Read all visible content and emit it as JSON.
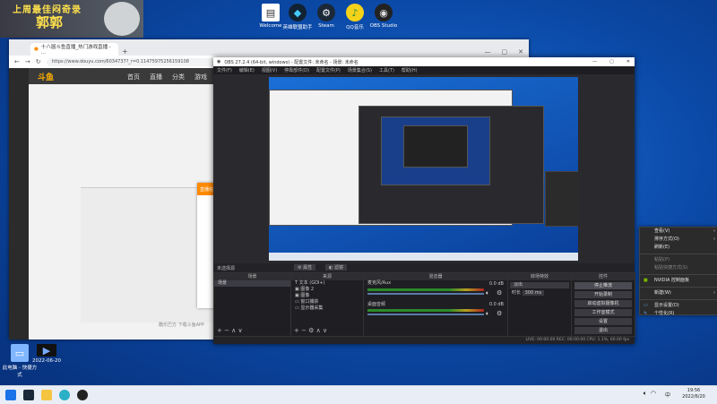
{
  "banner": {
    "title": "上周最佳闷奇录",
    "name": "郭郭"
  },
  "desktop_icons": [
    {
      "label": "Welcome",
      "icon": "document-icon"
    },
    {
      "label": "英雄联盟助手",
      "icon": "game-icon"
    },
    {
      "label": "Steam",
      "icon": "steam-icon"
    },
    {
      "label": "QQ音乐",
      "icon": "music-icon"
    },
    {
      "label": "OBS Studio",
      "icon": "obs-icon"
    }
  ],
  "desktop_bottom_icons": [
    {
      "label": "此电脑 - 快捷方式",
      "icon": "computer-icon"
    },
    {
      "label": "2022-06-20",
      "icon": "video-thumbnail-icon"
    }
  ],
  "browser": {
    "tab_title": "十八届斗鱼直播_热门游戏直播 - ...",
    "url": "https://www.douyu.com/6034737?_r=0.1147597525615910​8",
    "site_logo": "斗鱼",
    "nav": [
      "首页",
      "直播",
      "分类",
      "游戏"
    ],
    "popup_title": "直播信息",
    "footer_text": "酷乐巴方  下载斗鱼APP"
  },
  "obs": {
    "title": "OBS 27.2.4 (64-bit, windows) - 配置文件: 未命名 - 场景: 未命名",
    "menus": [
      "文件(F)",
      "编辑(E)",
      "视图(V)",
      "停靠部件(D)",
      "配置文件(P)",
      "场景集合(S)",
      "工具(T)",
      "帮助(H)"
    ],
    "source_bar": {
      "label": "未选择源",
      "props": "属性",
      "filters": "滤镜"
    },
    "scenes": {
      "title": "场景",
      "items": [
        "场景"
      ]
    },
    "sources": {
      "title": "来源",
      "items": [
        "文本 (GDI+)",
        "图像 2",
        "图像",
        "窗口捕获",
        "显示器采集"
      ]
    },
    "mixer": {
      "title": "混音器",
      "tracks": [
        {
          "name": "麦克风/Aux",
          "db": "0.0 dB"
        },
        {
          "name": "桌面音频",
          "db": "0.0 dB"
        }
      ]
    },
    "transitions": {
      "title": "转场特效",
      "type": "淡出",
      "duration_label": "时长",
      "duration": "300 ms"
    },
    "controls": {
      "title": "控件",
      "buttons": [
        "停止推流",
        "开始录制",
        "启动虚拟摄像机",
        "工作室模式",
        "设置",
        "退出"
      ]
    },
    "status": "LIVE: 00:00:00   REC: 00:00:00   CPU: 1.1%, 60.00 fps"
  },
  "context_menu": {
    "items": [
      {
        "label": "查看(V)",
        "sub": true,
        "dim": false
      },
      {
        "label": "排序方式(O)",
        "sub": true,
        "dim": false
      },
      {
        "label": "刷新(E)",
        "sub": false,
        "dim": false
      },
      {
        "sep": true
      },
      {
        "label": "粘贴(P)",
        "sub": false,
        "dim": true
      },
      {
        "label": "粘贴快捷方式(S)",
        "sub": false,
        "dim": true
      },
      {
        "sep": true
      },
      {
        "label": "NVIDIA 控制面板",
        "sub": false,
        "dim": false
      },
      {
        "sep": true
      },
      {
        "label": "新建(W)",
        "sub": true,
        "dim": false
      },
      {
        "sep": true
      },
      {
        "label": "显示设置(D)",
        "sub": false,
        "dim": false
      },
      {
        "label": "个性化(R)",
        "sub": false,
        "dim": false
      }
    ]
  },
  "taskbar": {
    "time": "19:56",
    "date": "2022/6/20",
    "lang": "中",
    "apps": [
      "windows-icon",
      "search-icon",
      "file-explorer-icon",
      "edge-icon",
      "steam-icon",
      "obs-icon"
    ]
  },
  "colors": {
    "accent": "#ff8a00",
    "desktop": "#0b4aa8"
  }
}
